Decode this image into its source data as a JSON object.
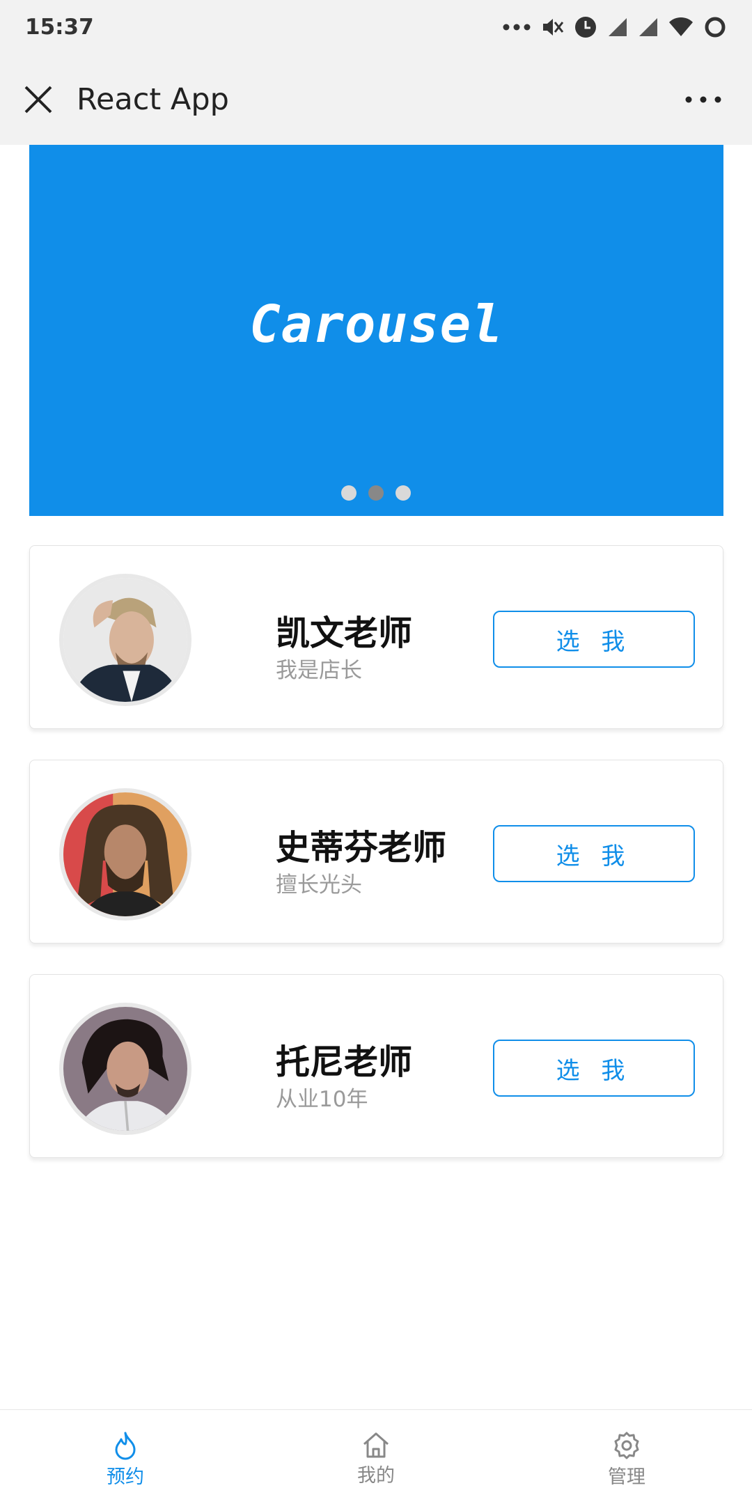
{
  "status_bar": {
    "time": "15:37"
  },
  "title_bar": {
    "title": "React App"
  },
  "carousel": {
    "text": "Carousel",
    "dot_count": 3,
    "active_dot": 1
  },
  "teachers": [
    {
      "name": "凯文老师",
      "desc": "我是店长",
      "button": "选 我"
    },
    {
      "name": "史蒂芬老师",
      "desc": "擅长光头",
      "button": "选 我"
    },
    {
      "name": "托尼老师",
      "desc": "从业10年",
      "button": "选 我"
    }
  ],
  "tab_bar": {
    "active": 0,
    "tabs": [
      {
        "label": "预约",
        "icon": "flame-icon"
      },
      {
        "label": "我的",
        "icon": "home-icon"
      },
      {
        "label": "管理",
        "icon": "gear-icon"
      }
    ]
  },
  "colors": {
    "accent": "#108ee9",
    "header_bg": "#f2f2f2"
  }
}
